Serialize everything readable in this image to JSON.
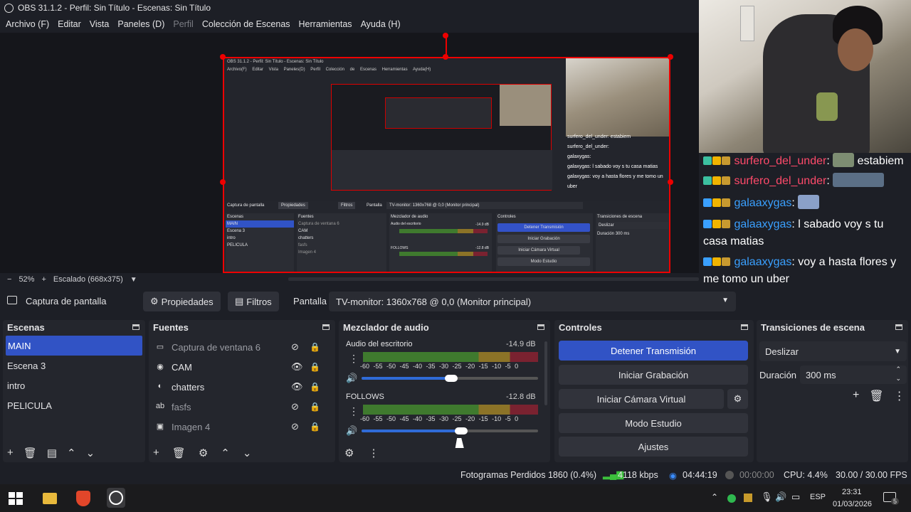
{
  "window": {
    "title": "OBS 31.1.2 - Perfil: Sin Título - Escenas: Sin Título"
  },
  "menu": [
    {
      "label": "Archivo (F)",
      "disabled": false
    },
    {
      "label": "Editar",
      "disabled": false
    },
    {
      "label": "Vista",
      "disabled": false
    },
    {
      "label": "Paneles (D)",
      "disabled": false
    },
    {
      "label": "Perfil",
      "disabled": true
    },
    {
      "label": "Colección de Escenas",
      "disabled": false
    },
    {
      "label": "Herramientas",
      "disabled": false
    },
    {
      "label": "Ayuda (H)",
      "disabled": false
    }
  ],
  "nested": {
    "title": "OBS 31.1.2 - Perfil: Sin Título - Escenas: Sin Título",
    "menu": "Archivo(F) Editar Vista Paneles(D) Perfil Colección de Escenas Herramientas Ayuda(H)",
    "source_label": "Captura de pantalla",
    "props": "Propiedades",
    "filters": "Filtros",
    "screen": "Pantalla",
    "monitor": "TV-monitor: 1360x768 @ 0,0 (Monitor principal)",
    "zoom": "52%",
    "scaled": "Escalado (668x375)",
    "scenes_title": "Escenas",
    "scenes": [
      "MAIN",
      "Escena 3",
      "intro",
      "PELICULA"
    ],
    "sources_title": "Fuentes",
    "sources": [
      "Captura de ventana 6",
      "CAM",
      "chatters",
      "fasfs",
      "Imagen 4"
    ],
    "mixer_title": "Mezclador de audio",
    "ch1": "Audio del escritorio",
    "ch1_db": "-14.9 dB",
    "ch2": "FOLLOWS",
    "ch2_db": "-12.8 dB",
    "controls_title": "Controles",
    "btns": [
      "Detener Transmisión",
      "Iniciar Grabación",
      "Iniciar Cámara Virtual",
      "Modo Estudio"
    ],
    "trans_title": "Transiciones de escena",
    "trans": "Deslizar",
    "duration": "Duración",
    "duration_val": "300 ms",
    "chat": [
      "surfero_del_under: estabiem",
      "surfero_del_under:",
      "galaxygas:",
      "galaxygas: l sabado voy s tu casa matias",
      "galaxygas: voy a hasta flores y me tomo un uber"
    ]
  },
  "chat": [
    {
      "user": "surfero_del_under",
      "color": "#ff4a6a",
      "text": "estabiem",
      "emote": true,
      "wide": false
    },
    {
      "user": "surfero_del_under",
      "color": "#ff4a6a",
      "text": "",
      "emote": true,
      "wide": true
    },
    {
      "user": "galaaxygas",
      "color": "#3aa0ff",
      "text": "",
      "emote": true,
      "wide": false
    },
    {
      "user": "galaaxygas",
      "color": "#3aa0ff",
      "text": "l sabado voy s tu casa matias",
      "emote": false,
      "wide": false
    },
    {
      "user": "galaaxygas",
      "color": "#3aa0ff",
      "text": "voy a hasta flores y me tomo un uber",
      "emote": false,
      "wide": false
    }
  ],
  "preview_bar": {
    "zoom": "52%",
    "scaled": "Escalado (668x375)"
  },
  "source_bar": {
    "source": "Captura de pantalla",
    "properties": "Propiedades",
    "filters": "Filtros",
    "screen_label": "Pantalla",
    "monitor": "TV-monitor: 1360x768 @ 0,0 (Monitor principal)"
  },
  "scenes": {
    "title": "Escenas",
    "items": [
      "MAIN",
      "Escena 3",
      "intro",
      "PELICULA"
    ],
    "selected": 0
  },
  "sources": {
    "title": "Fuentes",
    "items": [
      {
        "name": "Captura de ventana 6",
        "icon": "window-icon",
        "visible": false
      },
      {
        "name": "CAM",
        "icon": "camera-icon",
        "visible": true
      },
      {
        "name": "chatters",
        "icon": "browser-icon",
        "visible": true
      },
      {
        "name": "fasfs",
        "icon": "text-icon",
        "visible": false
      },
      {
        "name": "Imagen 4",
        "icon": "image-icon",
        "visible": false
      }
    ]
  },
  "mixer": {
    "title": "Mezclador de audio",
    "ticks": "-60 -55 -50 -45 -40 -35 -30 -25 -20 -15 -10 -5 0",
    "channels": [
      {
        "name": "Audio del escritorio",
        "db": "-14.9 dB",
        "volume": 0.9
      },
      {
        "name": "FOLLOWS",
        "db": "-12.8 dB",
        "volume": 1.0
      }
    ]
  },
  "controls": {
    "title": "Controles",
    "stop_stream": "Detener Transmisión",
    "start_recording": "Iniciar Grabación",
    "virtual_cam": "Iniciar Cámara Virtual",
    "studio_mode": "Modo Estudio",
    "settings": "Ajustes"
  },
  "transitions": {
    "title": "Transiciones de escena",
    "selected": "Deslizar",
    "duration_label": "Duración",
    "duration_value": "300 ms"
  },
  "status": {
    "dropped": "Fotogramas Perdidos 1860 (0.4%)",
    "bitrate": "4118 kbps",
    "stream_time": "04:44:19",
    "rec_time": "00:00:00",
    "cpu": "CPU: 4.4%",
    "fps": "30.00 / 30.00 FPS"
  },
  "taskbar": {
    "lang": "ESP",
    "time": "23:31",
    "date": "01/03/2026",
    "notifications": "5"
  },
  "colors": {
    "accent": "#3153c5",
    "record_red": "#e00000",
    "meter_green": "#3f7a2e",
    "meter_yellow": "#8c7327",
    "meter_red": "#7a2230"
  }
}
